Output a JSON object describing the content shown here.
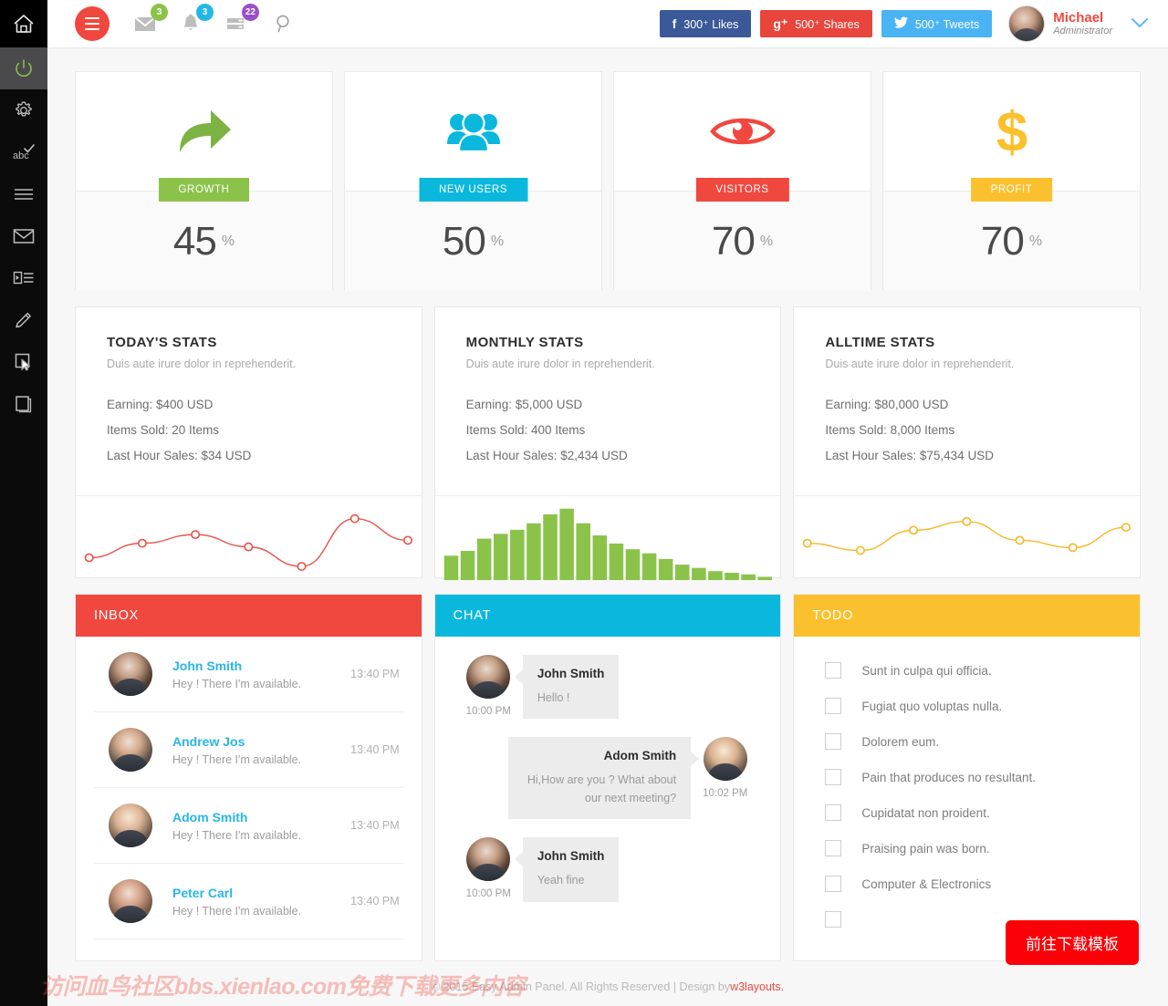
{
  "sidebar": {
    "home_icon": "home-icon",
    "items": [
      {
        "icon": "power-icon",
        "active": true
      },
      {
        "icon": "gear-icon",
        "active": false
      },
      {
        "icon": "abc-check-icon",
        "active": false
      },
      {
        "icon": "list-lines-icon",
        "active": false
      },
      {
        "icon": "envelope-icon",
        "active": false
      },
      {
        "icon": "indent-list-icon",
        "active": false
      },
      {
        "icon": "pencil-icon",
        "active": false
      },
      {
        "icon": "cursor-select-icon",
        "active": false
      },
      {
        "icon": "book-icon",
        "active": false
      }
    ]
  },
  "header": {
    "menu_toggle": "hamburger-icon",
    "icons": [
      {
        "name": "mail-icon",
        "count": "3",
        "color": "#8bc34a"
      },
      {
        "name": "bell-icon",
        "count": "3",
        "color": "#23b7e5"
      },
      {
        "name": "tasks-icon",
        "count": "22",
        "color": "#9c4dcc"
      }
    ],
    "search_icon": "search-icon",
    "social": [
      {
        "icon": "f",
        "label": "300⁺ Likes",
        "color": "#3b5998"
      },
      {
        "icon": "g⁺",
        "label": "500⁺ Shares",
        "color": "#e8453c"
      },
      {
        "icon": "twitter",
        "label": "500⁺ Tweets",
        "color": "#4ab3f4"
      }
    ],
    "profile": {
      "name": "Michael",
      "role": "Administrator",
      "caret": "chevron-down-icon"
    }
  },
  "stat_cards": [
    {
      "icon": "share-arrow-icon",
      "icon_color": "#7cb342",
      "label": "GROWTH",
      "label_class": "lbl-growth",
      "value": "45",
      "unit": "%"
    },
    {
      "icon": "users-icon",
      "icon_color": "#0bb8dd",
      "label": "NEW USERS",
      "label_class": "lbl-users",
      "value": "50",
      "unit": "%"
    },
    {
      "icon": "eye-icon",
      "icon_color": "#f0483e",
      "label": "VISITORS",
      "label_class": "lbl-visit",
      "value": "70",
      "unit": "%"
    },
    {
      "icon": "dollar-icon",
      "icon_color": "#fbc02d",
      "label": "PROFIT",
      "label_class": "lbl-profit",
      "value": "70",
      "unit": "%"
    }
  ],
  "stats_panels": [
    {
      "title": "TODAY'S STATS",
      "subtitle": "Duis aute irure dolor in reprehenderit.",
      "earning": "Earning: $400 USD",
      "items_sold": "Items Sold: 20 Items",
      "last_hour": "Last Hour Sales: $34 USD"
    },
    {
      "title": "MONTHLY STATS",
      "subtitle": "Duis aute irure dolor in reprehenderit.",
      "earning": "Earning: $5,000 USD",
      "items_sold": "Items Sold: 400 Items",
      "last_hour": "Last Hour Sales: $2,434 USD"
    },
    {
      "title": "ALLTIME STATS",
      "subtitle": "Duis aute irure dolor in reprehenderit.",
      "earning": "Earning: $80,000 USD",
      "items_sold": "Items Sold: 8,000 Items",
      "last_hour": "Last Hour Sales: $75,434 USD"
    }
  ],
  "chart_data": [
    {
      "type": "line",
      "title": "TODAY'S STATS",
      "series": [
        {
          "name": "Today",
          "values": [
            18,
            38,
            50,
            33,
            6,
            72,
            42
          ]
        }
      ],
      "x": [
        0,
        1,
        2,
        3,
        4,
        5,
        6
      ],
      "color": "#e8554e",
      "markers": true,
      "grid": false,
      "legend": "none",
      "ylim": [
        0,
        80
      ],
      "xlabel": "",
      "ylabel": ""
    },
    {
      "type": "bar",
      "title": "MONTHLY STATS",
      "categories": [
        "1",
        "2",
        "3",
        "4",
        "5",
        "6",
        "7",
        "8",
        "9",
        "10",
        "11",
        "12",
        "13",
        "14",
        "15",
        "16",
        "17",
        "18",
        "19",
        "20"
      ],
      "values": [
        30,
        36,
        51,
        57,
        62,
        70,
        81,
        88,
        70,
        55,
        45,
        38,
        33,
        26,
        19,
        15,
        11,
        9,
        7,
        4
      ],
      "color": "#8bc34a",
      "grid": false,
      "legend": "none",
      "ylim": [
        0,
        92
      ],
      "xlabel": "",
      "ylabel": ""
    },
    {
      "type": "line",
      "title": "ALLTIME STATS",
      "series": [
        {
          "name": "Alltime",
          "values": [
            38,
            28,
            56,
            68,
            42,
            32,
            60
          ]
        }
      ],
      "x": [
        0,
        1,
        2,
        3,
        4,
        5,
        6
      ],
      "color": "#f5b92a",
      "markers": true,
      "grid": false,
      "legend": "none",
      "ylim": [
        0,
        80
      ],
      "xlabel": "",
      "ylabel": ""
    }
  ],
  "inbox": {
    "title": "INBOX",
    "items": [
      {
        "name": "John Smith",
        "message": "Hey ! There I'm available.",
        "time": "13:40 PM",
        "avatar": "ava-dark"
      },
      {
        "name": "Andrew Jos",
        "message": "Hey ! There I'm available.",
        "time": "13:40 PM",
        "avatar": "ava-grey"
      },
      {
        "name": "Adom Smith",
        "message": "Hey ! There I'm available.",
        "time": "13:40 PM",
        "avatar": "ava-light"
      },
      {
        "name": "Peter Carl",
        "message": "Hey ! There I'm available.",
        "time": "13:40 PM",
        "avatar": "ava-warm"
      }
    ]
  },
  "chat": {
    "title": "CHAT",
    "messages": [
      {
        "name": "John Smith",
        "text": "Hello !",
        "time": "10:00 PM",
        "side": "left",
        "avatar": "ava-dark"
      },
      {
        "name": "Adom Smith",
        "text": "Hi,How are you ? What about our next meeting?",
        "time": "10:02 PM",
        "side": "right",
        "avatar": "ava-light"
      },
      {
        "name": "John Smith",
        "text": "Yeah fine",
        "time": "10:00 PM",
        "side": "left",
        "avatar": "ava-dark"
      }
    ]
  },
  "todo": {
    "title": "TODO",
    "items": [
      {
        "text": "Sunt in culpa qui officia."
      },
      {
        "text": "Fugiat quo voluptas nulla."
      },
      {
        "text": "Dolorem eum."
      },
      {
        "text": "Pain that produces no resultant."
      },
      {
        "text": "Cupidatat non proident."
      },
      {
        "text": "Praising pain was born."
      },
      {
        "text": "Computer & Electronics"
      },
      {
        "text": ""
      }
    ]
  },
  "footer": {
    "text": "© 2015 Easy Admin Panel. All Rights Reserved | Design by ",
    "link": "w3layouts."
  },
  "overlay": {
    "watermark": "访问血鸟社区bbs.xienlao.com免费下载更多内容",
    "download_button": "前往下载模板"
  },
  "theme": {
    "red": "#f0483e",
    "cyan": "#0bb8dd",
    "yellow": "#fbc02d",
    "green": "#8bc34a",
    "link_blue": "#29b6e8"
  }
}
